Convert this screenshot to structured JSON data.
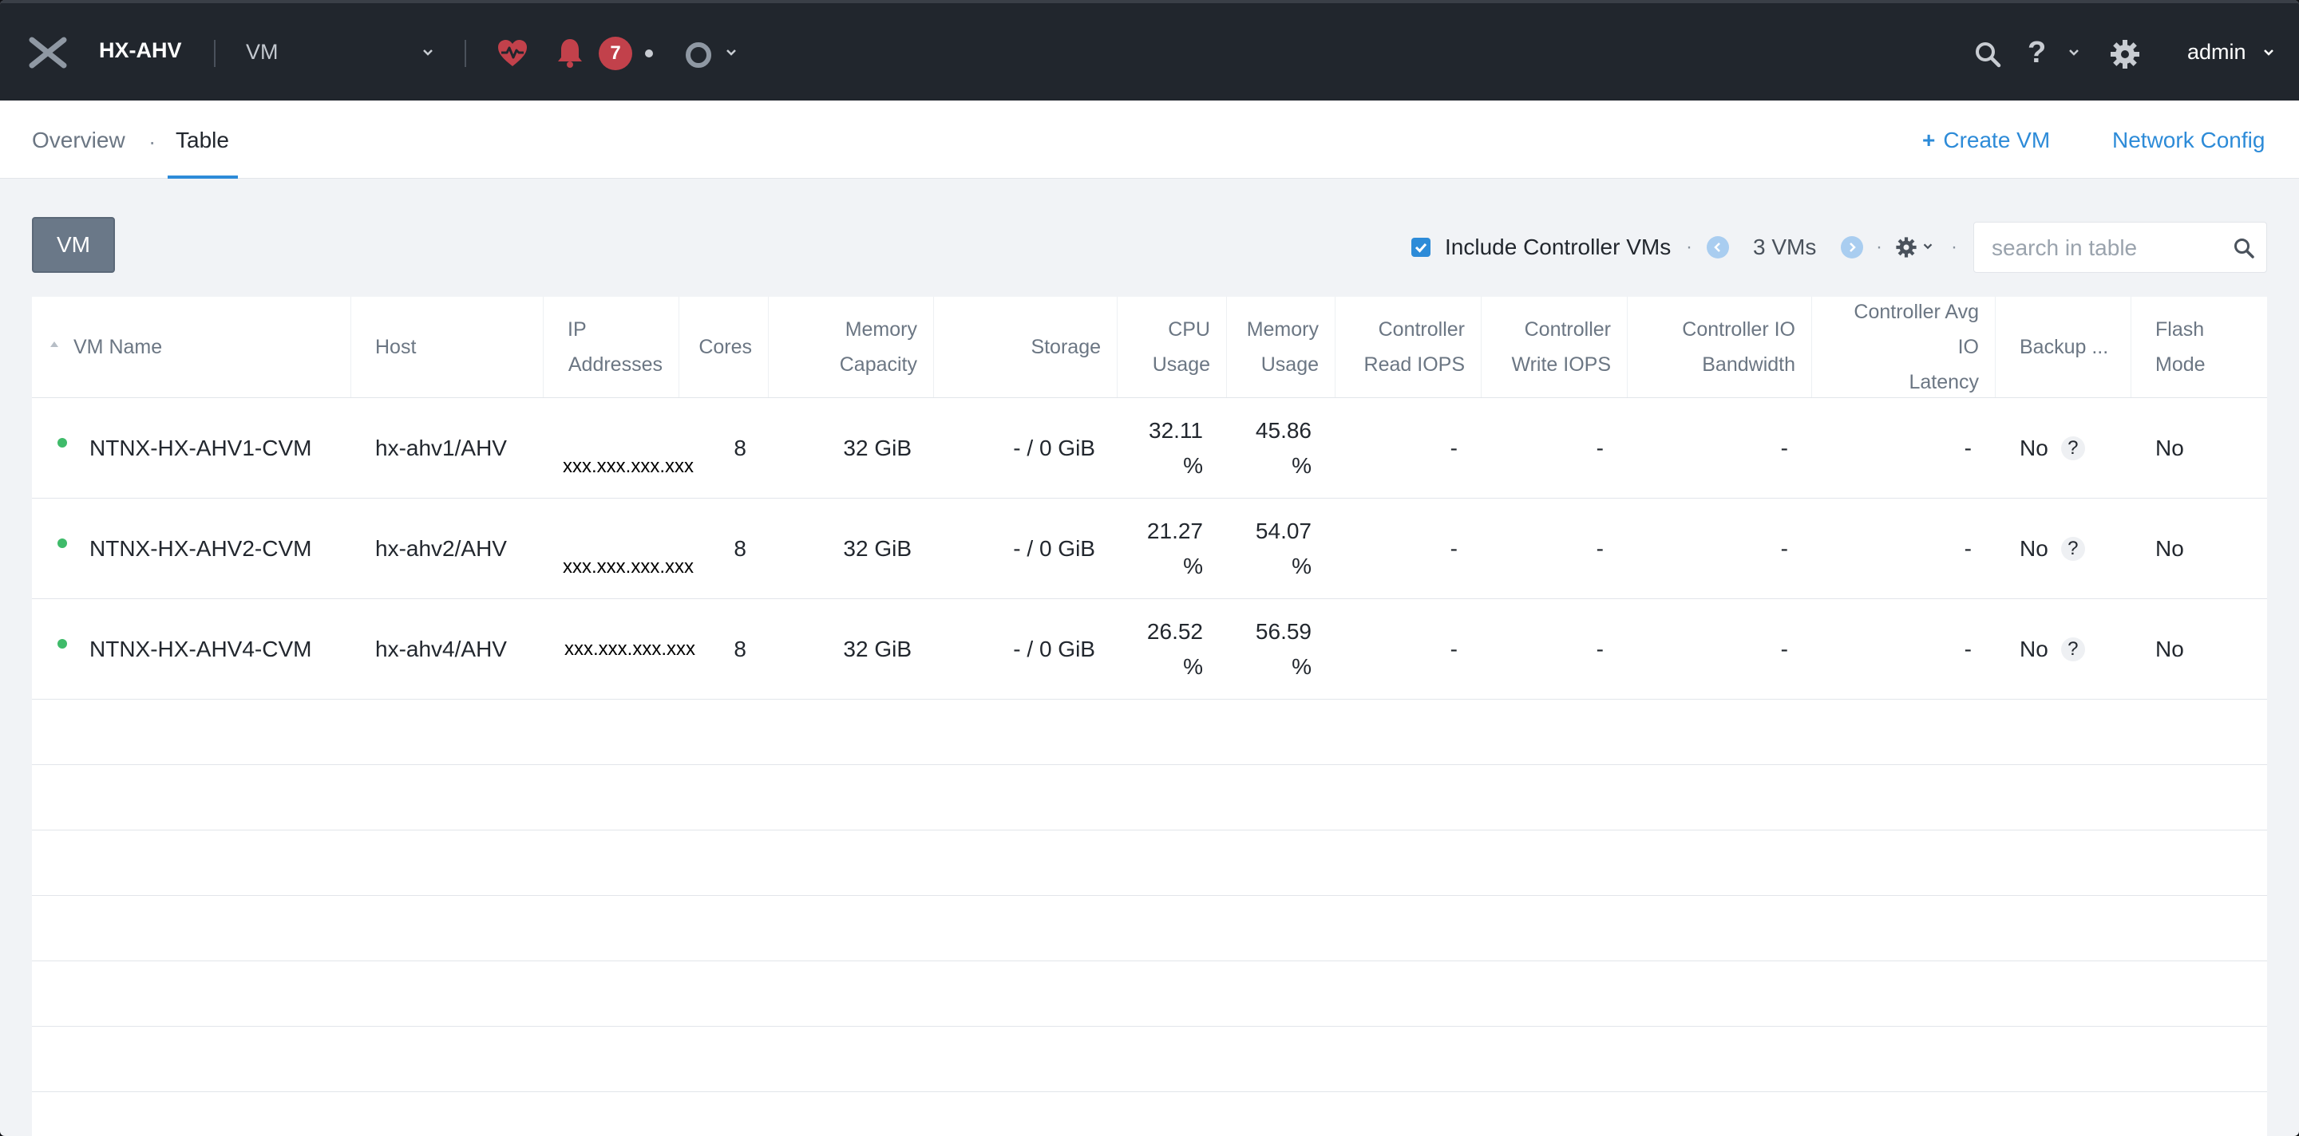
{
  "topbar": {
    "cluster_name": "HX-AHV",
    "entity_select": "VM",
    "alert_count": "7",
    "user": "admin",
    "help_glyph": "?"
  },
  "tabs": {
    "overview": "Overview",
    "separator": "·",
    "table": "Table"
  },
  "actions": {
    "create_plus": "+",
    "create_vm": "Create VM",
    "network_config": "Network Config"
  },
  "toolbar": {
    "entity_button": "VM",
    "include_controller_vms": "Include Controller VMs",
    "vm_count": "3 VMs",
    "dot": "·",
    "search_placeholder": "search in table"
  },
  "table": {
    "columns": {
      "vm_name": "VM Name",
      "host": "Host",
      "ip_1": "IP",
      "ip_2": "Addresses",
      "cores": "Cores",
      "mem_cap_1": "Memory",
      "mem_cap_2": "Capacity",
      "storage": "Storage",
      "cpu_1": "CPU",
      "cpu_2": "Usage",
      "mem_use_1": "Memory",
      "mem_use_2": "Usage",
      "ctrl_read_1": "Controller",
      "ctrl_read_2": "Read IOPS",
      "ctrl_write_1": "Controller",
      "ctrl_write_2": "Write IOPS",
      "ctrl_bw_1": "Controller IO",
      "ctrl_bw_2": "Bandwidth",
      "ctrl_lat_1": "Controller Avg IO",
      "ctrl_lat_2": "Latency",
      "backup": "Backup ...",
      "flash_1": "Flash",
      "flash_2": "Mode"
    },
    "rows": [
      {
        "name": "NTNX-HX-AHV1-CVM",
        "host": "hx-ahv1/AHV",
        "ip": "xxx.xxx.xxx.xxx",
        "cores": "8",
        "memory_capacity": "32 GiB",
        "storage": "- / 0 GiB",
        "cpu_value": "32.11",
        "cpu_unit": "%",
        "mem_value": "45.86",
        "mem_unit": "%",
        "ctrl_read": "-",
        "ctrl_write": "-",
        "ctrl_bw": "-",
        "ctrl_lat": "-",
        "backup": "No",
        "backup_help": "?",
        "flash": "No"
      },
      {
        "name": "NTNX-HX-AHV2-CVM",
        "host": "hx-ahv2/AHV",
        "ip": "xxx.xxx.xxx.xxx",
        "cores": "8",
        "memory_capacity": "32 GiB",
        "storage": "- / 0 GiB",
        "cpu_value": "21.27",
        "cpu_unit": "%",
        "mem_value": "54.07",
        "mem_unit": "%",
        "ctrl_read": "-",
        "ctrl_write": "-",
        "ctrl_bw": "-",
        "ctrl_lat": "-",
        "backup": "No",
        "backup_help": "?",
        "flash": "No"
      },
      {
        "name": "NTNX-HX-AHV4-CVM",
        "host": "hx-ahv4/AHV",
        "ip": "xxx.xxx.xxx.xxx",
        "cores": "8",
        "memory_capacity": "32 GiB",
        "storage": "- / 0 GiB",
        "cpu_value": "26.52",
        "cpu_unit": "%",
        "mem_value": "56.59",
        "mem_unit": "%",
        "ctrl_read": "-",
        "ctrl_write": "-",
        "ctrl_bw": "-",
        "ctrl_lat": "-",
        "backup": "No",
        "backup_help": "?",
        "flash": "No"
      }
    ]
  },
  "colors": {
    "topbar_bg": "#21262d",
    "accent": "#2d8bd8",
    "alert": "#c2414b",
    "status_ok": "#3fbb6a"
  }
}
